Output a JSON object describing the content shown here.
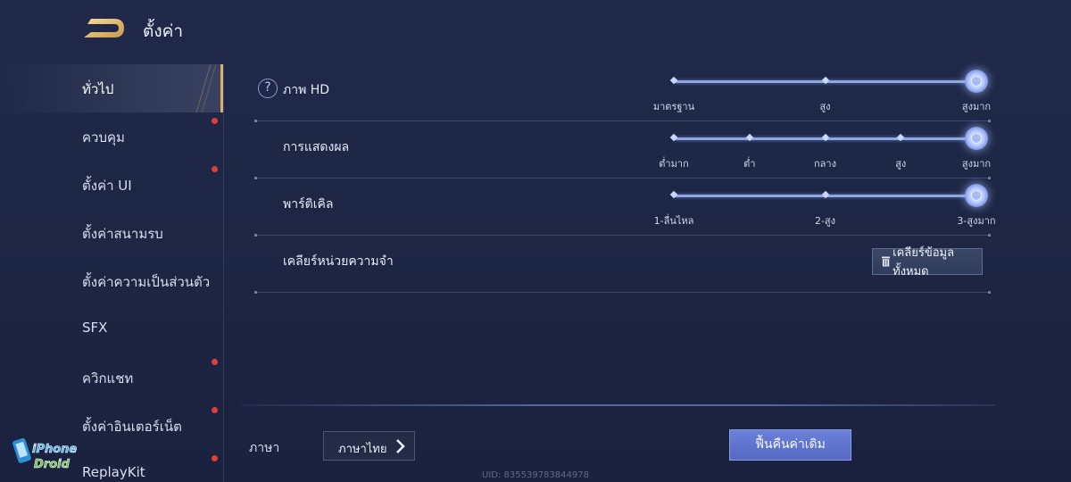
{
  "header": {
    "title": "ตั้งค่า"
  },
  "sidebar": {
    "items": [
      {
        "label": "ทั่วไป",
        "active": true,
        "dot": false
      },
      {
        "label": "ควบคุม",
        "active": false,
        "dot": true
      },
      {
        "label": "ตั้งค่า UI",
        "active": false,
        "dot": true
      },
      {
        "label": "ตั้งค่าสนามรบ",
        "active": false,
        "dot": false
      },
      {
        "label": "ตั้งค่าความเป็นส่วนตัว",
        "active": false,
        "dot": false
      },
      {
        "label": "SFX",
        "active": false,
        "dot": false
      },
      {
        "label": "ควิกแชท",
        "active": false,
        "dot": true
      },
      {
        "label": "ตั้งค่าอินเตอร์เน็ต",
        "active": false,
        "dot": true
      },
      {
        "label": "ReplayKit",
        "active": false,
        "dot": true
      }
    ]
  },
  "settings": {
    "hd": {
      "label": "ภาพ HD",
      "help": "?",
      "options": [
        "มาตรฐาน",
        "สูง",
        "สูงมาก"
      ],
      "selected_index": 2
    },
    "display": {
      "label": "การแสดงผล",
      "options": [
        "ต่ำมาก",
        "ต่ำ",
        "กลาง",
        "สูง",
        "สูงมาก"
      ],
      "selected_index": 4
    },
    "particle": {
      "label": "พาร์ติเคิล",
      "options": [
        "1-ลื่นไหล",
        "2-สูง",
        "3-สูงมาก"
      ],
      "selected_index": 2
    },
    "memory": {
      "label": "เคลียร์หน่วยความจำ",
      "button_label": "เคลียร์ข้อมูลทั้งหมด"
    }
  },
  "footer": {
    "language_label": "ภาษา",
    "language_value": "ภาษาไทย",
    "reset_label": "ฟื้นคืนค่าเดิม",
    "uid": "UID: 835539783844978"
  },
  "watermark": {
    "line1": "iPhone",
    "line2": "Droid"
  },
  "colors": {
    "accent": "#d8b06a",
    "slider": "#8ea6e8",
    "reset_button": "#5f74cf",
    "notification_dot": "#e23b3b"
  }
}
